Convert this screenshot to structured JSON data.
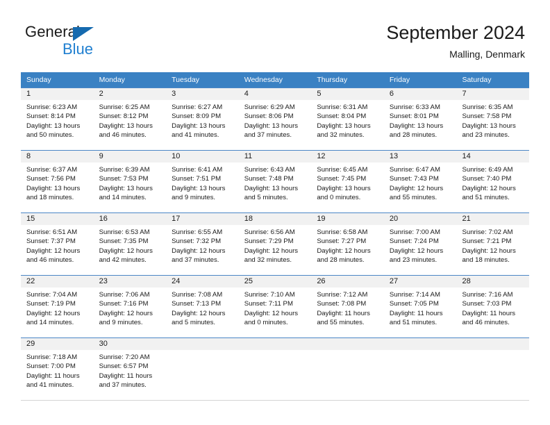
{
  "brand": {
    "name_part1": "General",
    "name_part2": "Blue",
    "flag_icon": "blue-triangle-flag-icon"
  },
  "header": {
    "title": "September 2024",
    "subtitle": "Malling, Denmark"
  },
  "calendar": {
    "weekday_headers": [
      "Sunday",
      "Monday",
      "Tuesday",
      "Wednesday",
      "Thursday",
      "Friday",
      "Saturday"
    ],
    "accent_color": "#3a81c3",
    "day_band_color": "#f1f1f1",
    "weeks": [
      [
        {
          "date": "1",
          "sunrise": "Sunrise: 6:23 AM",
          "sunset": "Sunset: 8:14 PM",
          "daylight1": "Daylight: 13 hours",
          "daylight2": "and 50 minutes."
        },
        {
          "date": "2",
          "sunrise": "Sunrise: 6:25 AM",
          "sunset": "Sunset: 8:12 PM",
          "daylight1": "Daylight: 13 hours",
          "daylight2": "and 46 minutes."
        },
        {
          "date": "3",
          "sunrise": "Sunrise: 6:27 AM",
          "sunset": "Sunset: 8:09 PM",
          "daylight1": "Daylight: 13 hours",
          "daylight2": "and 41 minutes."
        },
        {
          "date": "4",
          "sunrise": "Sunrise: 6:29 AM",
          "sunset": "Sunset: 8:06 PM",
          "daylight1": "Daylight: 13 hours",
          "daylight2": "and 37 minutes."
        },
        {
          "date": "5",
          "sunrise": "Sunrise: 6:31 AM",
          "sunset": "Sunset: 8:04 PM",
          "daylight1": "Daylight: 13 hours",
          "daylight2": "and 32 minutes."
        },
        {
          "date": "6",
          "sunrise": "Sunrise: 6:33 AM",
          "sunset": "Sunset: 8:01 PM",
          "daylight1": "Daylight: 13 hours",
          "daylight2": "and 28 minutes."
        },
        {
          "date": "7",
          "sunrise": "Sunrise: 6:35 AM",
          "sunset": "Sunset: 7:58 PM",
          "daylight1": "Daylight: 13 hours",
          "daylight2": "and 23 minutes."
        }
      ],
      [
        {
          "date": "8",
          "sunrise": "Sunrise: 6:37 AM",
          "sunset": "Sunset: 7:56 PM",
          "daylight1": "Daylight: 13 hours",
          "daylight2": "and 18 minutes."
        },
        {
          "date": "9",
          "sunrise": "Sunrise: 6:39 AM",
          "sunset": "Sunset: 7:53 PM",
          "daylight1": "Daylight: 13 hours",
          "daylight2": "and 14 minutes."
        },
        {
          "date": "10",
          "sunrise": "Sunrise: 6:41 AM",
          "sunset": "Sunset: 7:51 PM",
          "daylight1": "Daylight: 13 hours",
          "daylight2": "and 9 minutes."
        },
        {
          "date": "11",
          "sunrise": "Sunrise: 6:43 AM",
          "sunset": "Sunset: 7:48 PM",
          "daylight1": "Daylight: 13 hours",
          "daylight2": "and 5 minutes."
        },
        {
          "date": "12",
          "sunrise": "Sunrise: 6:45 AM",
          "sunset": "Sunset: 7:45 PM",
          "daylight1": "Daylight: 13 hours",
          "daylight2": "and 0 minutes."
        },
        {
          "date": "13",
          "sunrise": "Sunrise: 6:47 AM",
          "sunset": "Sunset: 7:43 PM",
          "daylight1": "Daylight: 12 hours",
          "daylight2": "and 55 minutes."
        },
        {
          "date": "14",
          "sunrise": "Sunrise: 6:49 AM",
          "sunset": "Sunset: 7:40 PM",
          "daylight1": "Daylight: 12 hours",
          "daylight2": "and 51 minutes."
        }
      ],
      [
        {
          "date": "15",
          "sunrise": "Sunrise: 6:51 AM",
          "sunset": "Sunset: 7:37 PM",
          "daylight1": "Daylight: 12 hours",
          "daylight2": "and 46 minutes."
        },
        {
          "date": "16",
          "sunrise": "Sunrise: 6:53 AM",
          "sunset": "Sunset: 7:35 PM",
          "daylight1": "Daylight: 12 hours",
          "daylight2": "and 42 minutes."
        },
        {
          "date": "17",
          "sunrise": "Sunrise: 6:55 AM",
          "sunset": "Sunset: 7:32 PM",
          "daylight1": "Daylight: 12 hours",
          "daylight2": "and 37 minutes."
        },
        {
          "date": "18",
          "sunrise": "Sunrise: 6:56 AM",
          "sunset": "Sunset: 7:29 PM",
          "daylight1": "Daylight: 12 hours",
          "daylight2": "and 32 minutes."
        },
        {
          "date": "19",
          "sunrise": "Sunrise: 6:58 AM",
          "sunset": "Sunset: 7:27 PM",
          "daylight1": "Daylight: 12 hours",
          "daylight2": "and 28 minutes."
        },
        {
          "date": "20",
          "sunrise": "Sunrise: 7:00 AM",
          "sunset": "Sunset: 7:24 PM",
          "daylight1": "Daylight: 12 hours",
          "daylight2": "and 23 minutes."
        },
        {
          "date": "21",
          "sunrise": "Sunrise: 7:02 AM",
          "sunset": "Sunset: 7:21 PM",
          "daylight1": "Daylight: 12 hours",
          "daylight2": "and 18 minutes."
        }
      ],
      [
        {
          "date": "22",
          "sunrise": "Sunrise: 7:04 AM",
          "sunset": "Sunset: 7:19 PM",
          "daylight1": "Daylight: 12 hours",
          "daylight2": "and 14 minutes."
        },
        {
          "date": "23",
          "sunrise": "Sunrise: 7:06 AM",
          "sunset": "Sunset: 7:16 PM",
          "daylight1": "Daylight: 12 hours",
          "daylight2": "and 9 minutes."
        },
        {
          "date": "24",
          "sunrise": "Sunrise: 7:08 AM",
          "sunset": "Sunset: 7:13 PM",
          "daylight1": "Daylight: 12 hours",
          "daylight2": "and 5 minutes."
        },
        {
          "date": "25",
          "sunrise": "Sunrise: 7:10 AM",
          "sunset": "Sunset: 7:11 PM",
          "daylight1": "Daylight: 12 hours",
          "daylight2": "and 0 minutes."
        },
        {
          "date": "26",
          "sunrise": "Sunrise: 7:12 AM",
          "sunset": "Sunset: 7:08 PM",
          "daylight1": "Daylight: 11 hours",
          "daylight2": "and 55 minutes."
        },
        {
          "date": "27",
          "sunrise": "Sunrise: 7:14 AM",
          "sunset": "Sunset: 7:05 PM",
          "daylight1": "Daylight: 11 hours",
          "daylight2": "and 51 minutes."
        },
        {
          "date": "28",
          "sunrise": "Sunrise: 7:16 AM",
          "sunset": "Sunset: 7:03 PM",
          "daylight1": "Daylight: 11 hours",
          "daylight2": "and 46 minutes."
        }
      ],
      [
        {
          "date": "29",
          "sunrise": "Sunrise: 7:18 AM",
          "sunset": "Sunset: 7:00 PM",
          "daylight1": "Daylight: 11 hours",
          "daylight2": "and 41 minutes."
        },
        {
          "date": "30",
          "sunrise": "Sunrise: 7:20 AM",
          "sunset": "Sunset: 6:57 PM",
          "daylight1": "Daylight: 11 hours",
          "daylight2": "and 37 minutes."
        },
        {
          "date": "",
          "sunrise": "",
          "sunset": "",
          "daylight1": "",
          "daylight2": ""
        },
        {
          "date": "",
          "sunrise": "",
          "sunset": "",
          "daylight1": "",
          "daylight2": ""
        },
        {
          "date": "",
          "sunrise": "",
          "sunset": "",
          "daylight1": "",
          "daylight2": ""
        },
        {
          "date": "",
          "sunrise": "",
          "sunset": "",
          "daylight1": "",
          "daylight2": ""
        },
        {
          "date": "",
          "sunrise": "",
          "sunset": "",
          "daylight1": "",
          "daylight2": ""
        }
      ]
    ]
  }
}
